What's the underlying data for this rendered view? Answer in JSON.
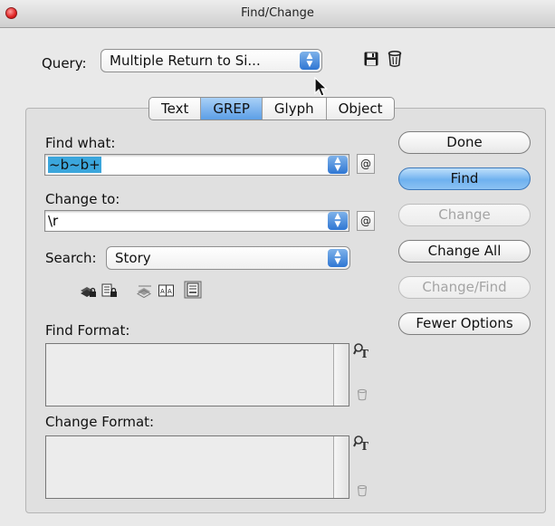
{
  "window": {
    "title": "Find/Change"
  },
  "query": {
    "label": "Query:",
    "value": "Multiple Return to Si..."
  },
  "tabs": [
    {
      "label": "Text"
    },
    {
      "label": "GREP"
    },
    {
      "label": "Glyph"
    },
    {
      "label": "Object"
    }
  ],
  "find_what": {
    "label": "Find what:",
    "value": "~b~b+"
  },
  "change_to": {
    "label": "Change to:",
    "value": "\\r"
  },
  "special_char_button": "@",
  "search": {
    "label": "Search:",
    "value": "Story"
  },
  "find_format": {
    "label": "Find Format:"
  },
  "change_format": {
    "label": "Change Format:"
  },
  "buttons": {
    "done": "Done",
    "find": "Find",
    "change": "Change",
    "change_all": "Change All",
    "change_find": "Change/Find",
    "fewer_options": "Fewer Options"
  },
  "colors": {
    "selected_tab": "#6fa9ea",
    "default_button": "#7ab8f0",
    "selection_highlight": "#3ba6dc",
    "close_button": "#e02424"
  },
  "icons": [
    "close-icon",
    "save-query-icon",
    "delete-query-icon",
    "pointer-cursor-icon",
    "include-locked-layers-icon",
    "include-locked-stories-icon",
    "include-hidden-layers-icon",
    "include-master-pages-icon",
    "include-footnotes-icon",
    "specify-format-icon",
    "clear-format-icon"
  ]
}
